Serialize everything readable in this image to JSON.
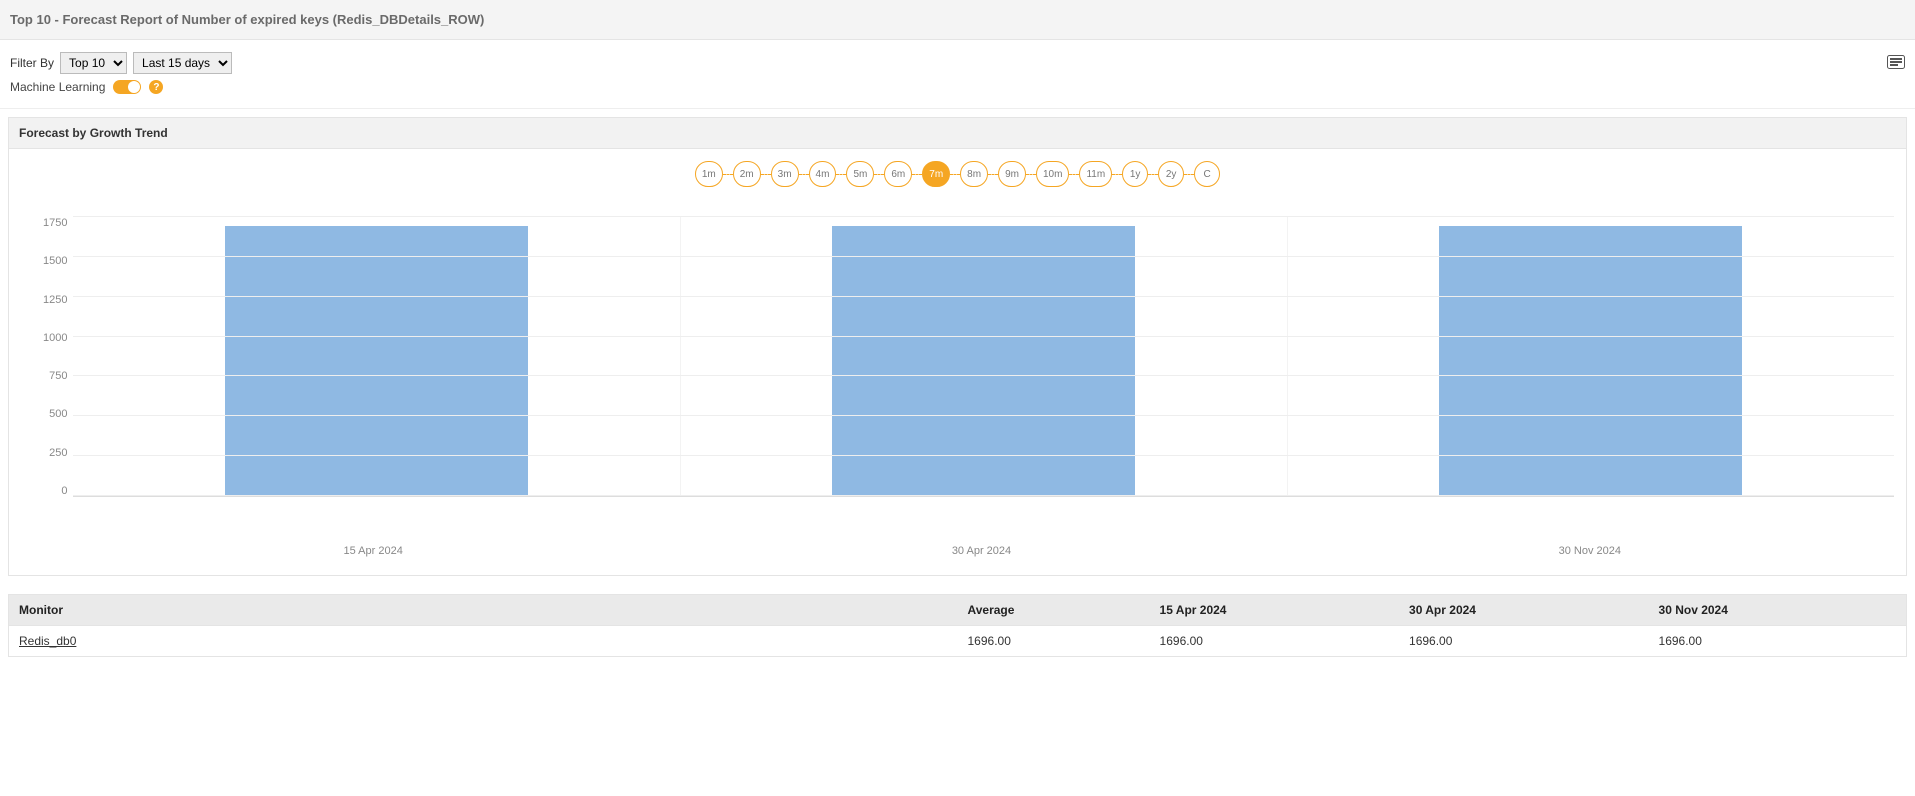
{
  "header": {
    "title": "Top 10 - Forecast Report of Number of expired keys (Redis_DBDetails_ROW)"
  },
  "filters": {
    "label": "Filter By",
    "top_options": [
      "Top 10"
    ],
    "top_selected": "Top 10",
    "range_options": [
      "Last 15 days"
    ],
    "range_selected": "Last 15 days"
  },
  "ml": {
    "label": "Machine Learning",
    "enabled": true,
    "help": "?"
  },
  "section": {
    "title": "Forecast by Growth Trend"
  },
  "range_pills": [
    {
      "label": "1m",
      "active": false
    },
    {
      "label": "2m",
      "active": false
    },
    {
      "label": "3m",
      "active": false
    },
    {
      "label": "4m",
      "active": false
    },
    {
      "label": "5m",
      "active": false
    },
    {
      "label": "6m",
      "active": false
    },
    {
      "label": "7m",
      "active": true
    },
    {
      "label": "8m",
      "active": false
    },
    {
      "label": "9m",
      "active": false
    },
    {
      "label": "10m",
      "active": false
    },
    {
      "label": "11m",
      "active": false
    },
    {
      "label": "1y",
      "active": false
    },
    {
      "label": "2y",
      "active": false
    },
    {
      "label": "C",
      "active": false
    }
  ],
  "chart_data": {
    "type": "bar",
    "categories": [
      "15 Apr 2024",
      "30 Apr 2024",
      "30 Nov 2024"
    ],
    "values": [
      1696,
      1696,
      1696
    ],
    "ylim": [
      0,
      1750
    ],
    "yticks": [
      0,
      250,
      500,
      750,
      1000,
      1250,
      1500,
      1750
    ],
    "series": [
      {
        "name": "Redis_db0",
        "values": [
          1696,
          1696,
          1696
        ]
      }
    ],
    "bar_color": "#8fb9e3"
  },
  "table": {
    "columns": [
      "Monitor",
      "Average",
      "15 Apr 2024",
      "30 Apr 2024",
      "30 Nov 2024"
    ],
    "rows": [
      {
        "monitor": "Redis_db0",
        "average": "1696.00",
        "c1": "1696.00",
        "c2": "1696.00",
        "c3": "1696.00"
      }
    ]
  }
}
